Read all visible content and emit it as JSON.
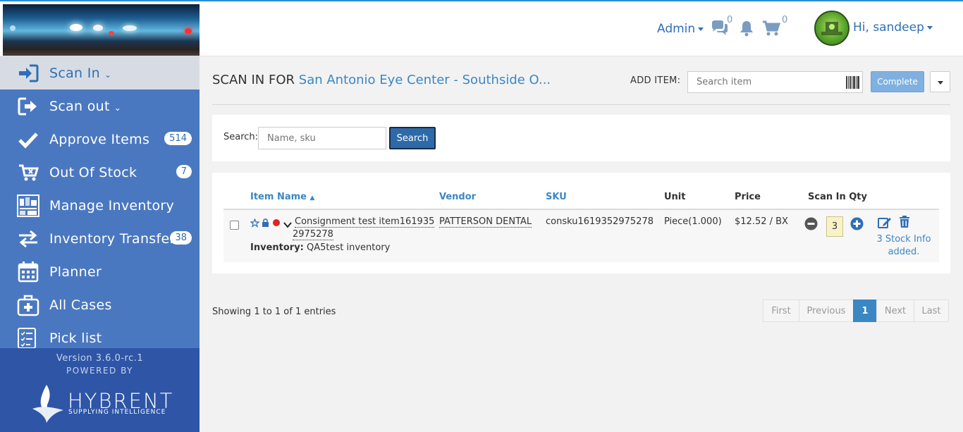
{
  "header": {
    "admin_label": "Admin",
    "messages_count": "0",
    "cart_count": "0",
    "greeting": "Hi, sandeep"
  },
  "sidebar": {
    "items": [
      {
        "label": "Scan In",
        "icon": "sign-in-icon",
        "badge": "",
        "active": true
      },
      {
        "label": "Scan out",
        "icon": "sign-out-icon",
        "badge": ""
      },
      {
        "label": "Approve Items",
        "icon": "checkmark-icon",
        "badge": "514"
      },
      {
        "label": "Out Of Stock",
        "icon": "cart-remove-icon",
        "badge": "7"
      },
      {
        "label": "Manage Inventory",
        "icon": "inventory-icon",
        "badge": ""
      },
      {
        "label": "Inventory Transfer",
        "icon": "transfer-arrows-icon",
        "badge": "38"
      },
      {
        "label": "Planner",
        "icon": "calendar-icon",
        "badge": ""
      },
      {
        "label": "All Cases",
        "icon": "medical-case-icon",
        "badge": ""
      },
      {
        "label": "Pick list",
        "icon": "checklist-icon",
        "badge": ""
      }
    ],
    "version": "Version 3.6.0-rc.1",
    "powered_by": "POWERED BY",
    "brand": "HYBRENT",
    "tagline": "SUPPLYING INTELLIGENCE"
  },
  "page": {
    "title_prefix": "SCAN IN FOR",
    "location": "San Antonio Eye Center - Southside O...",
    "add_item_label": "ADD ITEM:",
    "add_item_placeholder": "Search item",
    "complete_label": "Complete"
  },
  "search": {
    "label": "Search:",
    "placeholder": "Name, sku",
    "button_label": "Search"
  },
  "table": {
    "columns": [
      "Item Name",
      "Vendor",
      "SKU",
      "Unit",
      "Price",
      "Scan In Qty"
    ],
    "row": {
      "item_name_line1": "Consignment test item161935",
      "item_name_line2": "2975278",
      "inventory_label": "Inventory:",
      "inventory_value": "QA5test inventory",
      "vendor": "PATTERSON DENTAL",
      "sku": "consku1619352975278",
      "unit": "Piece(1.000)",
      "price": "$12.52 / BX",
      "qty": "3",
      "stock_info_line1": "3 Stock Info",
      "stock_info_line2": "added."
    }
  },
  "footer": {
    "showing": "Showing 1 to 1 of 1 entries",
    "pages": [
      "First",
      "Previous",
      "1",
      "Next",
      "Last"
    ]
  },
  "colors": {
    "accent": "#3a87c4",
    "sidebar_bg": "#4a78c0",
    "sidebar_footer": "#2e55a6",
    "status_dot": "#e02424"
  }
}
